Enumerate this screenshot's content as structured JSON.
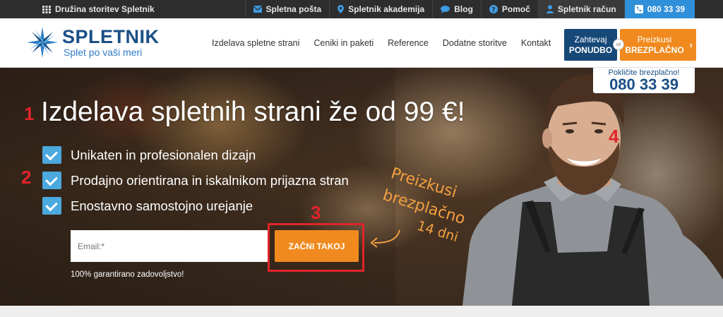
{
  "topbar": {
    "family_label": "Družina storitev Spletnik",
    "links": [
      {
        "label": "Spletna pošta",
        "icon": "envelope-icon"
      },
      {
        "label": "Spletnik akademija",
        "icon": "pin-icon"
      },
      {
        "label": "Blog",
        "icon": "chat-icon"
      },
      {
        "label": "Pomoč",
        "icon": "question-icon"
      },
      {
        "label": "Spletnik račun",
        "icon": "user-icon"
      },
      {
        "label": "080 33 39",
        "icon": "phone-icon"
      }
    ]
  },
  "header": {
    "brand": "SPLETNIK",
    "tagline": "Splet po vaši meri",
    "nav": [
      "Izdelava spletne strani",
      "Ceniki in paketi",
      "Reference",
      "Dodatne storitve",
      "Kontakt"
    ],
    "cta_offer": {
      "line1": "Zahtevaj",
      "line2": "PONUDBO"
    },
    "cta_or": "ali",
    "cta_trial": {
      "line1": "Preizkusi",
      "line2": "BREZPLAČNO"
    }
  },
  "hero": {
    "call_label": "Pokličite brezplačno!",
    "call_number": "080 33 39",
    "headline": "Izdelava spletnih strani že od 99 €!",
    "features": [
      "Unikaten in profesionalen dizajn",
      "Prodajno orientirana in iskalnikom prijazna stran",
      "Enostavno samostojno urejanje"
    ],
    "email_placeholder": "Email:*",
    "start_button": "ZAČNI TAKOJ",
    "guarantee": "100% garantirano zadovoljstvo!",
    "handwritten": [
      "Preizkusi",
      "brezplačno",
      "14 dni"
    ],
    "markers": [
      "1",
      "2",
      "3",
      "4"
    ]
  },
  "colors": {
    "accent_orange": "#f08a1e",
    "brand_blue": "#1b4f86",
    "phone_blue": "#2f8fd8",
    "check_blue": "#4ba9de",
    "annotation_red": "#e0242a"
  }
}
